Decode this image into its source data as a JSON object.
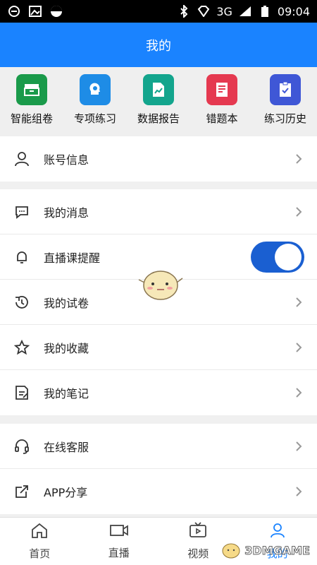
{
  "status": {
    "time": "09:04",
    "network": "3G"
  },
  "header": {
    "title": "我的"
  },
  "quick": [
    {
      "label": "智能组卷",
      "color": "#1a9a4a",
      "icon": "drawer-icon"
    },
    {
      "label": "专项练习",
      "color": "#1e8ce6",
      "icon": "brain-icon"
    },
    {
      "label": "数据报告",
      "color": "#13a58d",
      "icon": "report-icon"
    },
    {
      "label": "错题本",
      "color": "#e53950",
      "icon": "notebook-icon"
    },
    {
      "label": "练习历史",
      "color": "#3f57d6",
      "icon": "history-icon"
    }
  ],
  "sections": {
    "account": [
      {
        "label": "账号信息",
        "icon": "user-icon"
      }
    ],
    "main": [
      {
        "label": "我的消息",
        "icon": "message-icon"
      },
      {
        "label": "直播课提醒",
        "icon": "bell-icon",
        "toggle": true
      },
      {
        "label": "我的试卷",
        "icon": "history-clock-icon"
      },
      {
        "label": "我的收藏",
        "icon": "star-icon"
      },
      {
        "label": "我的笔记",
        "icon": "notes-icon"
      }
    ],
    "support": [
      {
        "label": "在线客服",
        "icon": "headset-icon"
      },
      {
        "label": "APP分享",
        "icon": "share-icon"
      }
    ]
  },
  "tabs": [
    {
      "label": "首页",
      "icon": "home-icon"
    },
    {
      "label": "直播",
      "icon": "video-camera-icon"
    },
    {
      "label": "视频",
      "icon": "tv-icon"
    },
    {
      "label": "我的",
      "icon": "person-icon",
      "active": true
    }
  ],
  "watermark": "3DMGAME"
}
